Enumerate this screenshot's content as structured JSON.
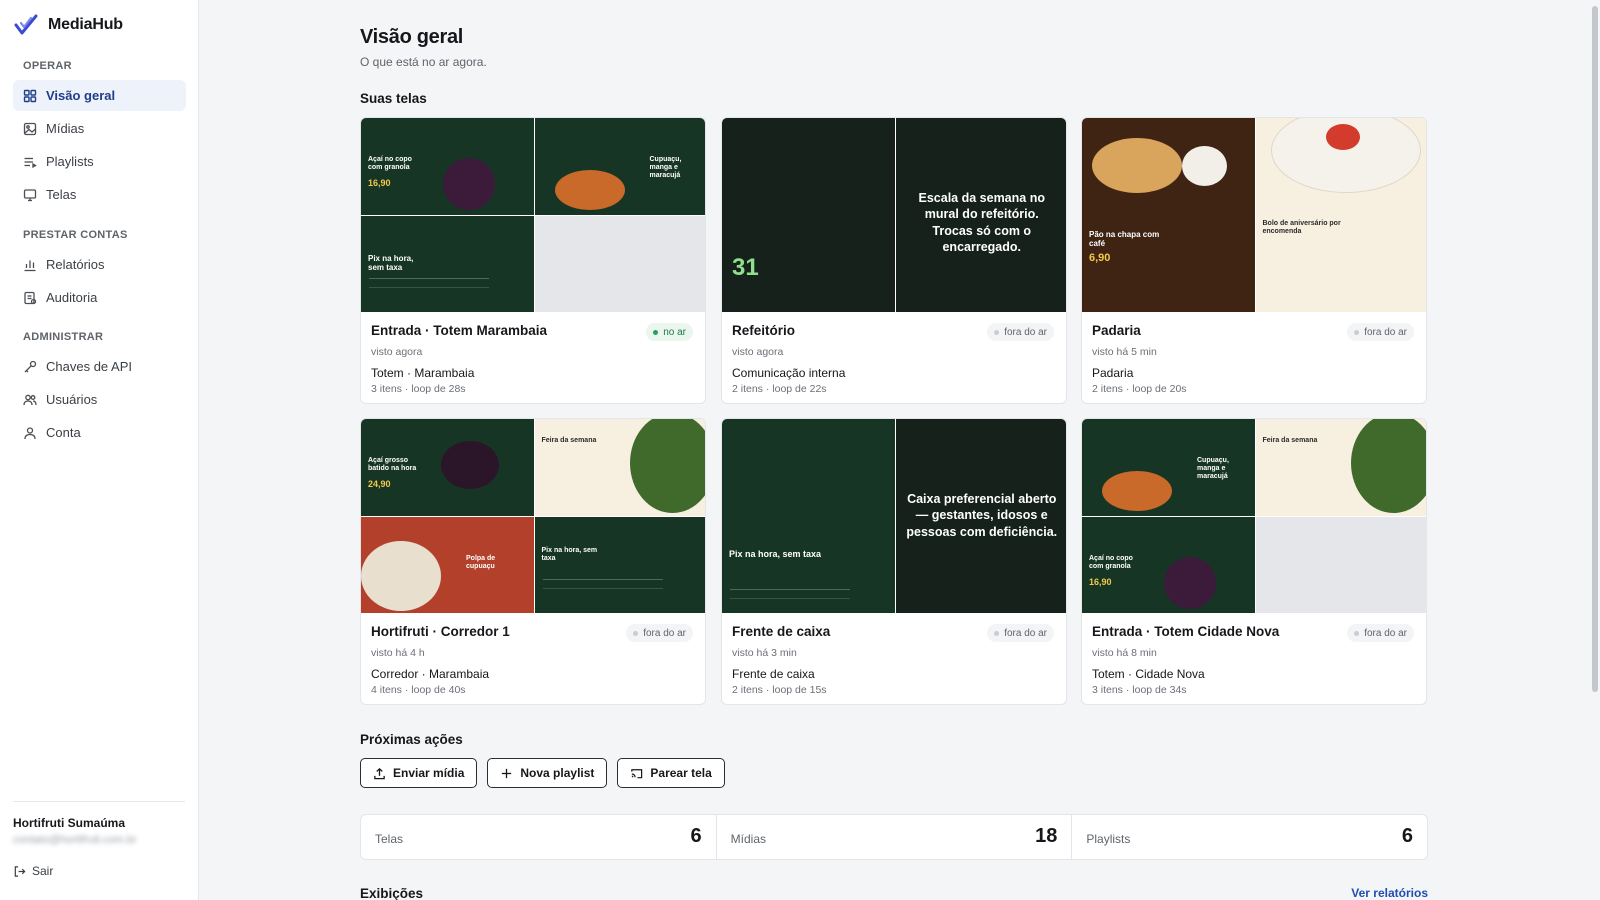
{
  "app": {
    "name": "MediaHub"
  },
  "sidebar": {
    "sections": [
      {
        "heading": "OPERAR",
        "items": [
          {
            "label": "Visão geral",
            "icon": "grid-icon",
            "active": true
          },
          {
            "label": "Mídias",
            "icon": "image-icon"
          },
          {
            "label": "Playlists",
            "icon": "list-icon"
          },
          {
            "label": "Telas",
            "icon": "monitor-icon"
          }
        ]
      },
      {
        "heading": "PRESTAR CONTAS",
        "items": [
          {
            "label": "Relatórios",
            "icon": "bar-chart-icon"
          },
          {
            "label": "Auditoria",
            "icon": "audit-icon"
          }
        ]
      },
      {
        "heading": "ADMINISTRAR",
        "items": [
          {
            "label": "Chaves de API",
            "icon": "key-icon"
          },
          {
            "label": "Usuários",
            "icon": "users-icon"
          },
          {
            "label": "Conta",
            "icon": "user-icon"
          }
        ]
      }
    ],
    "org_name": "Hortifruti Sumaúma",
    "org_email": "contato@hortifruti.com.br",
    "logout_label": "Sair"
  },
  "header": {
    "title": "Visão geral",
    "subtitle": "O que está no ar agora."
  },
  "screens_section": {
    "title": "Suas telas"
  },
  "screens": [
    {
      "name": "Entrada · Totem Marambaia",
      "status": "no ar",
      "live": true,
      "seen": "visto agora",
      "playlist": "Totem · Marambaia",
      "meta": "3 itens · loop de 28s",
      "tiles": {
        "t1_text": "Açaí no copo com granola",
        "t1_price": "16,90",
        "t2_text": "Cupuaçu, manga e maracujá",
        "t3_text": "Pix na hora, sem taxa"
      }
    },
    {
      "name": "Refeitório",
      "status": "fora do ar",
      "live": false,
      "seen": "visto agora",
      "playlist": "Comunicação interna",
      "meta": "2 itens · loop de 22s",
      "tiles": {
        "big_number": "31",
        "overlay": "Escala da semana no mural do refeitório. Trocas só com o encarregado."
      }
    },
    {
      "name": "Padaria",
      "status": "fora do ar",
      "live": false,
      "seen": "visto há 5 min",
      "playlist": "Padaria",
      "meta": "2 itens · loop de 20s",
      "tiles": {
        "t1_text": "Pão na chapa com café",
        "t1_price": "6,90",
        "t2_text": "Bolo de aniversário por encomenda"
      }
    },
    {
      "name": "Hortifruti · Corredor 1",
      "status": "fora do ar",
      "live": false,
      "seen": "visto há 4 h",
      "playlist": "Corredor · Marambaia",
      "meta": "4 itens · loop de 40s",
      "tiles": {
        "t1_text": "Açaí grosso batido na hora",
        "t1_price": "24,90",
        "t2_text": "Feira da semana",
        "t3_text": "Polpa de cupuaçu",
        "t4_text": "Pix na hora, sem taxa"
      }
    },
    {
      "name": "Frente de caixa",
      "status": "fora do ar",
      "live": false,
      "seen": "visto há 3 min",
      "playlist": "Frente de caixa",
      "meta": "2 itens · loop de 15s",
      "tiles": {
        "t1_text": "Pix na hora, sem taxa",
        "overlay": "Caixa preferencial aberto — gestantes, idosos e pessoas com deficiência."
      }
    },
    {
      "name": "Entrada · Totem Cidade Nova",
      "status": "fora do ar",
      "live": false,
      "seen": "visto há 8 min",
      "playlist": "Totem · Cidade Nova",
      "meta": "3 itens · loop de 34s",
      "tiles": {
        "t1_text": "Cupuaçu, manga e maracujá",
        "t2_text": "Feira da semana",
        "t3_text": "Açaí no copo com granola",
        "t3_price": "16,90"
      }
    }
  ],
  "next_actions": {
    "title": "Próximas ações",
    "buttons": {
      "upload": "Enviar mídia",
      "new_playlist": "Nova playlist",
      "pair": "Parear tela"
    }
  },
  "stats": [
    {
      "label": "Telas",
      "value": "6"
    },
    {
      "label": "Mídias",
      "value": "18"
    },
    {
      "label": "Playlists",
      "value": "6"
    }
  ],
  "exibicoes": {
    "title": "Exibições",
    "link": "Ver relatórios"
  },
  "colors": {
    "accent": "#1f3d8a",
    "live": "#22a35b",
    "tile_green": "#173524"
  }
}
